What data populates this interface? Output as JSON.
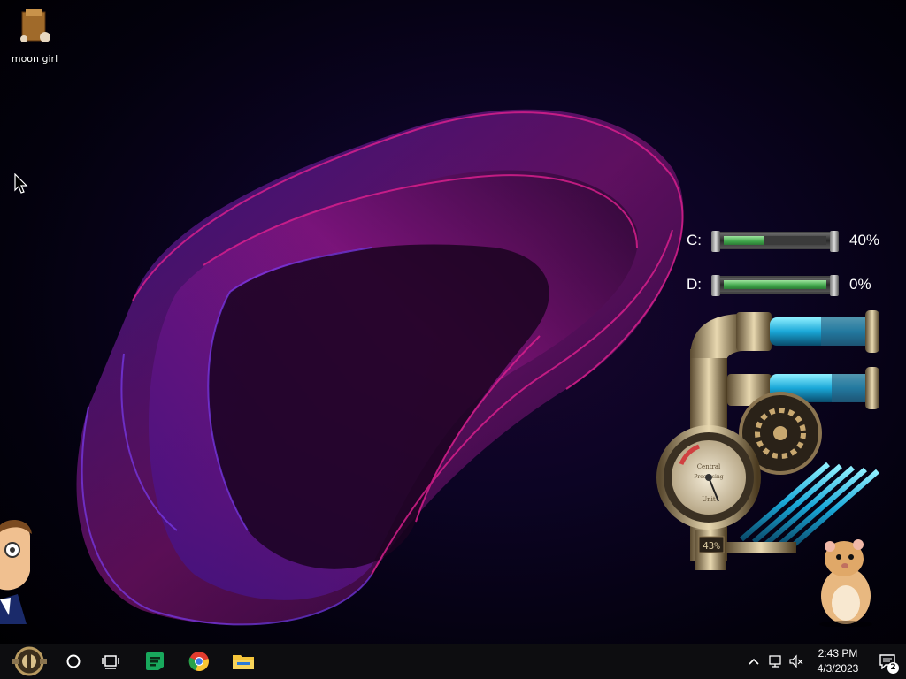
{
  "desktop": {
    "icons": [
      {
        "label": "moon girl",
        "icon": "moon-girl-app-icon"
      }
    ]
  },
  "drive_meter": {
    "drives": [
      {
        "label": "C:",
        "percent_text": "40%",
        "fill_fraction": 0.4
      },
      {
        "label": "D:",
        "percent_text": "0%",
        "fill_fraction": 1.0
      }
    ]
  },
  "gauge": {
    "readout": "43%",
    "dial_text": [
      "Central",
      "Processing",
      "Unit"
    ]
  },
  "taskbar": {
    "start_icon": "steampunk-start-orb-icon",
    "search_icon": "cortana-circle-icon",
    "task_view_icon": "task-view-icon",
    "pinned": [
      {
        "name": "sheets-app-icon",
        "color": "#18a85c"
      },
      {
        "name": "chrome-icon",
        "color": "#e23b2e"
      },
      {
        "name": "file-explorer-icon",
        "color": "#f5c53a"
      }
    ]
  },
  "tray": {
    "time": "2:43 PM",
    "date": "4/3/2023",
    "notification_count": "2"
  },
  "colors": {
    "accent_magenta": "#c0169a",
    "accent_violet": "#6a2bd8",
    "taskbar": "#0d0d10"
  }
}
